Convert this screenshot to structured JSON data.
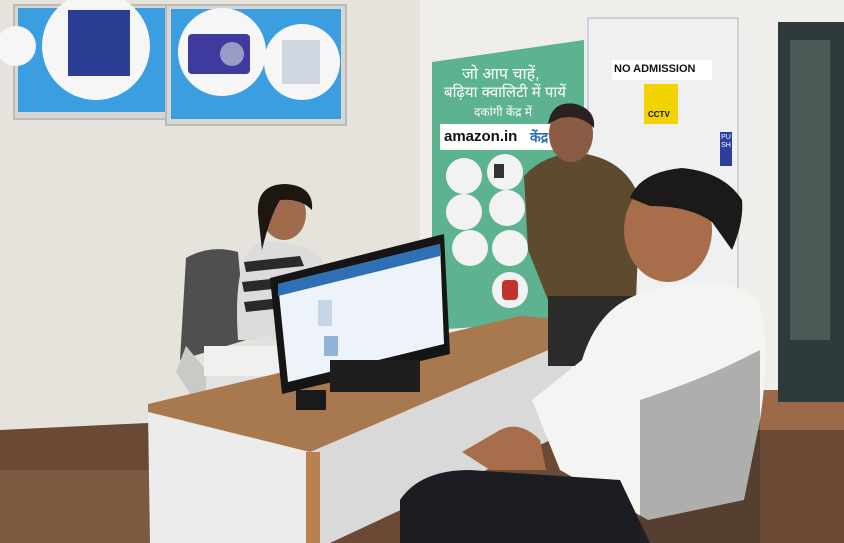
{
  "banner": {
    "line1": "जो आप चाहें,",
    "line2": "बढ़िया क्वालिटी में पायें",
    "line3": "दकांगी केंद्र में",
    "brand": "amazon.in",
    "brand_suffix": "केंद्र"
  },
  "signs": {
    "no_admission": "NO ADMISSION",
    "cctv": "CCTV",
    "push": "PUSH"
  },
  "colors": {
    "wall": "#e9e6df",
    "banner_green": "#5db38f",
    "light_box_blue": "#2f9ad8",
    "desk_wood": "#a8794f",
    "cctv_yellow": "#f2d200",
    "push_blue": "#2b3f9e"
  }
}
